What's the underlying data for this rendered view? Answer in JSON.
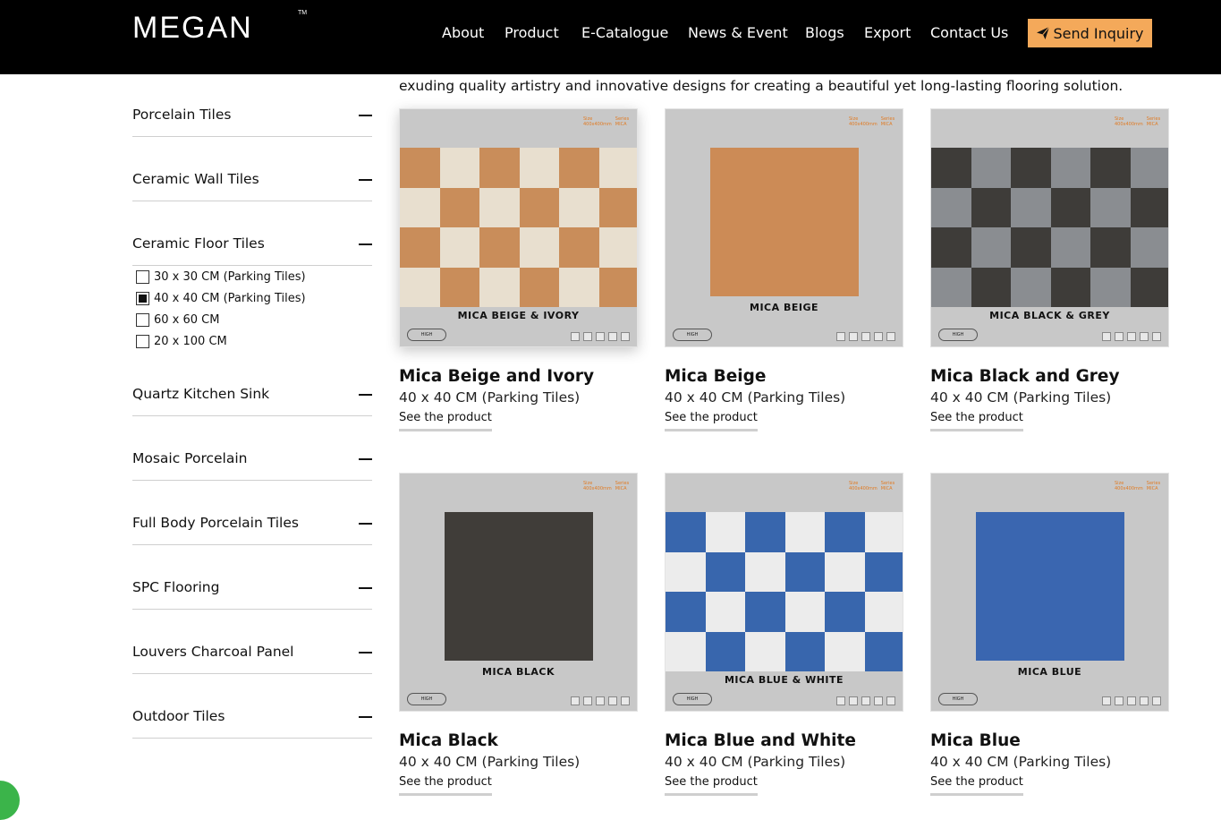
{
  "header": {
    "logo": "MEGAN",
    "logo_tm": "TM",
    "nav": [
      "About",
      "Product",
      "E-Catalogue",
      "News & Event",
      "Blogs",
      "Export",
      "Contact Us"
    ],
    "inquiry_label": "Send Inquiry"
  },
  "intro": "exuding quality artistry and innovative designs for creating a beautiful yet long-lasting flooring solution.",
  "sidebar": {
    "categories": [
      "Porcelain Tiles",
      "Ceramic Wall Tiles",
      "Ceramic Floor Tiles",
      "Quartz Kitchen Sink",
      "Mosaic Porcelain",
      "Full Body Porcelain Tiles",
      "SPC Flooring",
      "Louvers Charcoal Panel",
      "Outdoor Tiles"
    ],
    "sub_options": [
      {
        "label": "30 x 30 CM (Parking Tiles)",
        "checked": false
      },
      {
        "label": "40 x 40 CM (Parking Tiles)",
        "checked": true
      },
      {
        "label": "60 x 60 CM",
        "checked": false
      },
      {
        "label": "20 x 100 CM",
        "checked": false
      }
    ]
  },
  "spec": {
    "size_label": "Size",
    "size_value": "400x400mm",
    "series_label": "Series",
    "series_value": "MICA"
  },
  "brand_mark": "HIGH",
  "products": [
    {
      "title": "Mica Beige and Ivory",
      "size": "40 x 40 CM (Parking Tiles)",
      "link": "See the product",
      "tile_label": "MICA BEIGE & IVORY",
      "pattern": "checker",
      "color_a": "#c98d5a",
      "color_b": "#e8dfcf"
    },
    {
      "title": "Mica Beige",
      "size": "40 x 40 CM (Parking Tiles)",
      "link": "See the product",
      "tile_label": "MICA BEIGE",
      "pattern": "solid",
      "color_a": "#cc8b56"
    },
    {
      "title": "Mica Black and Grey",
      "size": "40 x 40 CM (Parking Tiles)",
      "link": "See the product",
      "tile_label": "MICA BLACK & GREY",
      "pattern": "checker",
      "color_a": "#3e3c39",
      "color_b": "#8a8d91"
    },
    {
      "title": "Mica Black",
      "size": "40 x 40 CM (Parking Tiles)",
      "link": "See the product",
      "tile_label": "MICA BLACK",
      "pattern": "solid",
      "color_a": "#403d39"
    },
    {
      "title": "Mica Blue and White",
      "size": "40 x 40 CM (Parking Tiles)",
      "link": "See the product",
      "tile_label": "MICA BLUE & WHITE",
      "pattern": "checker",
      "color_a": "#3866ad",
      "color_b": "#ececec"
    },
    {
      "title": "Mica Blue",
      "size": "40 x 40 CM (Parking Tiles)",
      "link": "See the product",
      "tile_label": "MICA BLUE",
      "pattern": "solid",
      "color_a": "#3a66b0"
    }
  ],
  "colors": {
    "header_bg": "#000000",
    "accent": "#f4a95a"
  }
}
